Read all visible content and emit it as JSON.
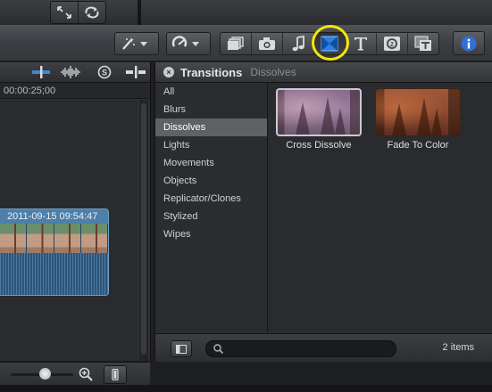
{
  "timeline": {
    "timecode": "00:00:25;00",
    "clip_title": "2011-09-15 09:54:47"
  },
  "transitions": {
    "title": "Transitions",
    "breadcrumb": "Dissolves",
    "categories": [
      "All",
      "Blurs",
      "Dissolves",
      "Lights",
      "Movements",
      "Objects",
      "Replicator/Clones",
      "Stylized",
      "Wipes"
    ],
    "selected_category": "Dissolves",
    "items": [
      {
        "label": "Cross Dissolve",
        "selected": true
      },
      {
        "label": "Fade To Color",
        "selected": false
      }
    ],
    "item_count": "2 items",
    "search_placeholder": ""
  },
  "colors": {
    "highlight_ring": "#f3e70a",
    "info_button": "#2f6fd6",
    "active_transition_icon": "#2f7fe0"
  },
  "icons": [
    "fullscreen-icon",
    "loop-icon",
    "magic-wand-icon",
    "retime-icon",
    "photos-icon",
    "camera-icon",
    "music-icon",
    "transitions-icon",
    "titles-icon",
    "generators-icon",
    "themes-icon",
    "info-icon"
  ]
}
